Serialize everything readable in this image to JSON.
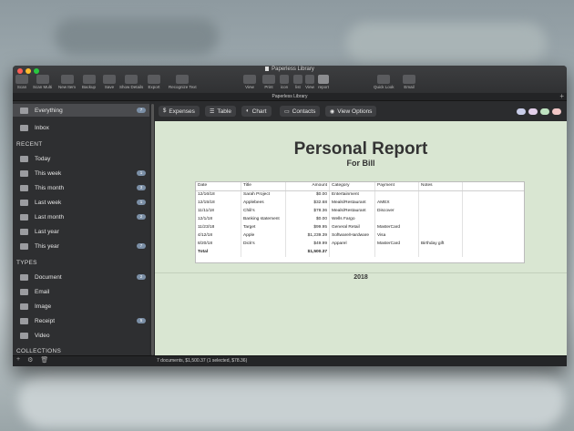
{
  "window": {
    "title": "Paperless Library",
    "traffic_lights": [
      "#ff5f57",
      "#febc2e",
      "#28c840"
    ]
  },
  "toolbar": {
    "left_buttons": [
      {
        "label": "Scan",
        "icon": "scanner-icon"
      },
      {
        "label": "Scan Multi",
        "icon": "scanner-multi-icon"
      },
      {
        "label": "New Item",
        "icon": "new-item-icon"
      },
      {
        "label": "Backup",
        "icon": "backup-icon"
      },
      {
        "label": "Save",
        "icon": "save-icon"
      },
      {
        "label": "Show Details",
        "icon": "info-icon"
      },
      {
        "label": "Export",
        "icon": "export-icon"
      },
      {
        "label": "Recognize Text",
        "icon": "recognize-text-icon"
      }
    ],
    "center_buttons": [
      {
        "label": "View",
        "icon": "view-icon"
      },
      {
        "label": "Print",
        "icon": "print-icon"
      },
      {
        "label": "icon",
        "icon": "icon-view-icon"
      },
      {
        "label": "list",
        "icon": "list-view-icon"
      },
      {
        "label": "View",
        "icon": "view-toggle-icon"
      },
      {
        "label": "report",
        "icon": "report-icon"
      }
    ],
    "right_buttons": [
      {
        "label": "Quick Look",
        "icon": "eye-icon"
      },
      {
        "label": "Email",
        "icon": "email-icon"
      }
    ]
  },
  "subbar": {
    "library_name": "Paperless Library",
    "add_symbol": "+"
  },
  "sidebar": {
    "top_items": [
      {
        "label": "Everything",
        "badge": "7"
      },
      {
        "label": "Inbox",
        "badge": ""
      }
    ],
    "recent_heading": "RECENT",
    "recent_items": [
      {
        "label": "Today",
        "badge": ""
      },
      {
        "label": "This week",
        "badge": "1"
      },
      {
        "label": "This month",
        "badge": "3"
      },
      {
        "label": "Last week",
        "badge": "1"
      },
      {
        "label": "Last month",
        "badge": "2"
      },
      {
        "label": "Last year",
        "badge": ""
      },
      {
        "label": "This year",
        "badge": "7"
      }
    ],
    "types_heading": "TYPES",
    "types_items": [
      {
        "label": "Document",
        "badge": "2"
      },
      {
        "label": "Email",
        "badge": ""
      },
      {
        "label": "Image",
        "badge": ""
      },
      {
        "label": "Receipt",
        "badge": "5"
      },
      {
        "label": "Video",
        "badge": ""
      }
    ],
    "collections_heading": "COLLECTIONS"
  },
  "status": {
    "text": "7 documents, $1,500.37 (1 selected, $78.36)"
  },
  "main_toolbar": {
    "buttons": [
      {
        "icon_glyph": "$",
        "label": "Expenses"
      },
      {
        "icon_glyph": "☰",
        "label": "Table"
      },
      {
        "icon_glyph": "◐",
        "label": "Chart"
      },
      {
        "icon_glyph": "▭",
        "label": "Contacts"
      },
      {
        "icon_glyph": "◉",
        "label": "View Options"
      }
    ],
    "color_dots": [
      "#c9cde8",
      "#e3d0ea",
      "#bfe3c1",
      "#f1c7c7"
    ]
  },
  "report": {
    "title": "Personal Report",
    "subtitle": "For Bill",
    "columns": [
      "Date",
      "Title",
      "Amount",
      "Category",
      "Payment",
      "Notes",
      ""
    ],
    "rows": [
      [
        "12/16/18",
        "Sarah Project",
        "$0.00",
        "Entertainment",
        "",
        "",
        ""
      ],
      [
        "12/15/18",
        "Applebees",
        "$32.68",
        "Meals/Restaurant",
        "AMEX",
        "",
        ""
      ],
      [
        "11/11/18",
        "Chili's",
        "$78.36",
        "Meals/Restaurant",
        "Discover",
        "",
        ""
      ],
      [
        "12/1/18",
        "Banking statement",
        "$0.00",
        "Wells Fargo",
        "",
        "",
        ""
      ],
      [
        "11/23/18",
        "Target",
        "$99.95",
        "General Retail",
        "MasterCard",
        "",
        ""
      ],
      [
        "4/12/18",
        "Apple",
        "$1,239.39",
        "Software/Hardware",
        "Visa",
        "",
        ""
      ],
      [
        "8/20/18",
        "Dick's",
        "$49.99",
        "Apparel",
        "MasterCard",
        "Birthday gift",
        ""
      ],
      [
        "Total",
        "",
        "$1,500.37",
        "",
        "",
        "",
        ""
      ]
    ],
    "year_label": "2018"
  }
}
